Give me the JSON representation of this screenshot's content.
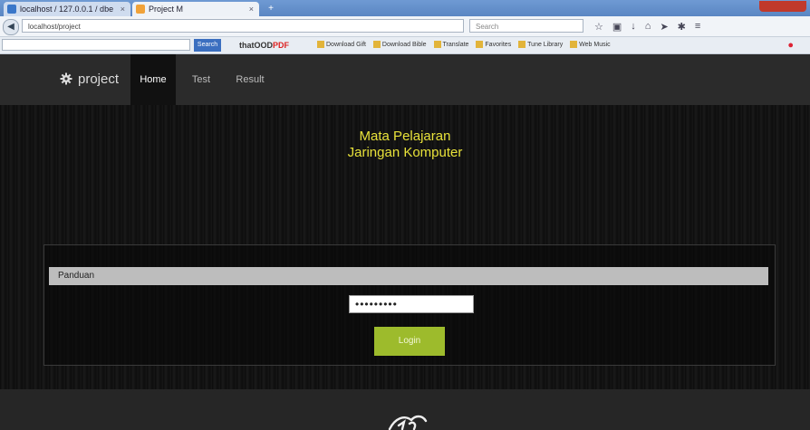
{
  "browser": {
    "tabs": [
      {
        "title": "localhost / 127.0.0.1 / dbe"
      },
      {
        "title": "Project M"
      }
    ],
    "new_tab_glyph": "+",
    "window_controls_label": "",
    "url": "localhost/project",
    "search_placeholder": "Search",
    "bookmark_search_placeholder": "",
    "bookmark_search_button": "Search",
    "bookmark_logo_prefix": "thatOOD",
    "bookmark_logo_suffix": "PDF",
    "bookmarks": [
      "Download Gift",
      "Download Bible",
      "Translate",
      "Favorites",
      "Tune Library",
      "Web Music"
    ]
  },
  "site": {
    "brand": "project",
    "nav": [
      {
        "label": "Home",
        "active": true
      },
      {
        "label": "Test",
        "active": false
      },
      {
        "label": "Result",
        "active": false
      }
    ]
  },
  "main": {
    "subject_line1": "Mata Pelajaran",
    "subject_line2": "Jaringan Komputer",
    "panel_title": "Panduan",
    "password_mask": "•••••••••",
    "login_label": "Login"
  },
  "colors": {
    "accent_yellow": "#e8e23a",
    "login_green": "#9dbb2c",
    "nav_bg": "#2b2b2b"
  },
  "icons": {
    "brand": "gear-icon",
    "footer": "dragon-logo-icon"
  }
}
